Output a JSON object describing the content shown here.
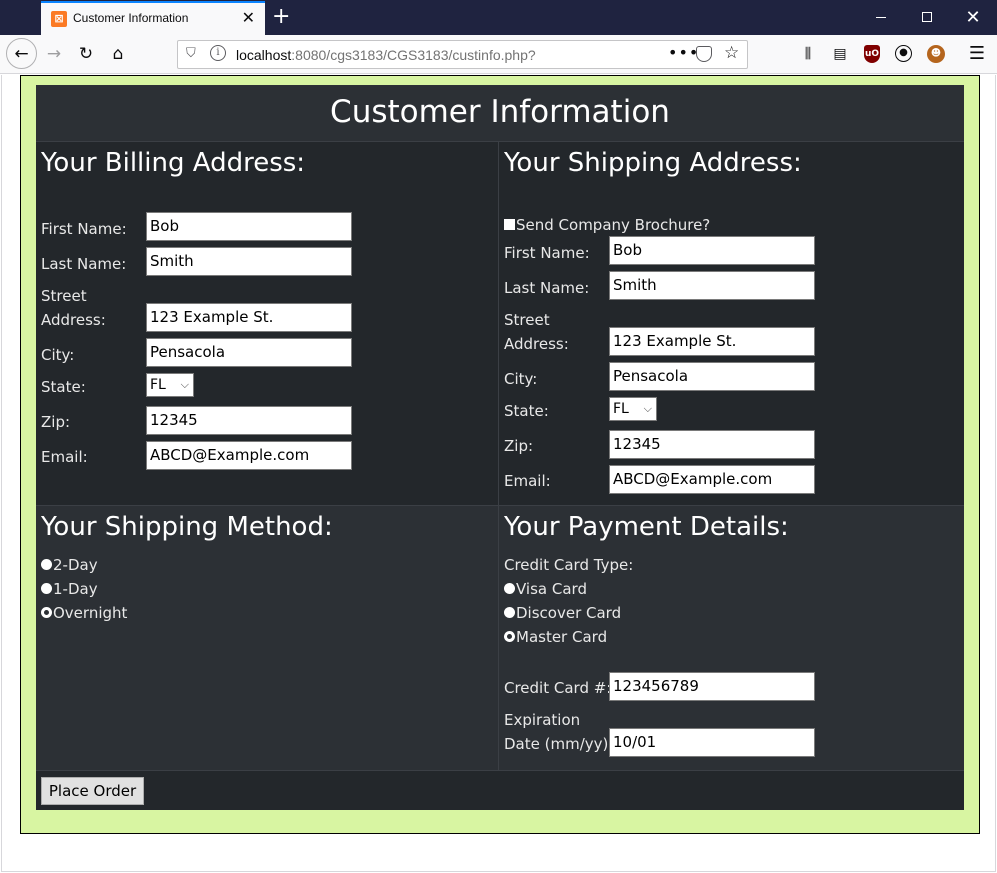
{
  "browser": {
    "tab_title": "Customer Information",
    "url_host": "localhost",
    "url_rest": ":8080/cgs3183/CGS3183/custinfo.php?"
  },
  "page": {
    "title": "Customer Information",
    "billing": {
      "heading": "Your Billing Address:",
      "first_name_label": "First Name:",
      "first_name": "Bob",
      "last_name_label": "Last Name:",
      "last_name": "Smith",
      "street_label_1": "Street",
      "street_label_2": "Address:",
      "street": "123 Example St.",
      "city_label": "City:",
      "city": "Pensacola",
      "state_label": "State:",
      "state": "FL",
      "zip_label": "Zip:",
      "zip": "12345",
      "email_label": "Email:",
      "email": "ABCD@Example.com"
    },
    "shipping": {
      "heading": "Your Shipping Address:",
      "brochure_label": "Send Company Brochure?",
      "brochure_checked": true,
      "first_name_label": "First Name:",
      "first_name": "Bob",
      "last_name_label": "Last Name:",
      "last_name": "Smith",
      "street_label_1": "Street",
      "street_label_2": "Address:",
      "street": "123 Example St.",
      "city_label": "City:",
      "city": "Pensacola",
      "state_label": "State:",
      "state": "FL",
      "zip_label": "Zip:",
      "zip": "12345",
      "email_label": "Email:",
      "email": "ABCD@Example.com"
    },
    "method": {
      "heading": "Your Shipping Method:",
      "options": [
        "2-Day",
        "1-Day",
        "Overnight"
      ],
      "selected": "Overnight"
    },
    "payment": {
      "heading": "Your Payment Details:",
      "card_type_label": "Credit Card Type:",
      "card_types": [
        "Visa Card",
        "Discover Card",
        "Master Card"
      ],
      "selected_card": "Master Card",
      "card_number_label": "Credit Card #:",
      "card_number": "123456789",
      "expiration_label_1": "Expiration",
      "expiration_label_2": "Date (mm/yy):",
      "expiration": "10/01"
    },
    "place_order_label": "Place Order"
  }
}
